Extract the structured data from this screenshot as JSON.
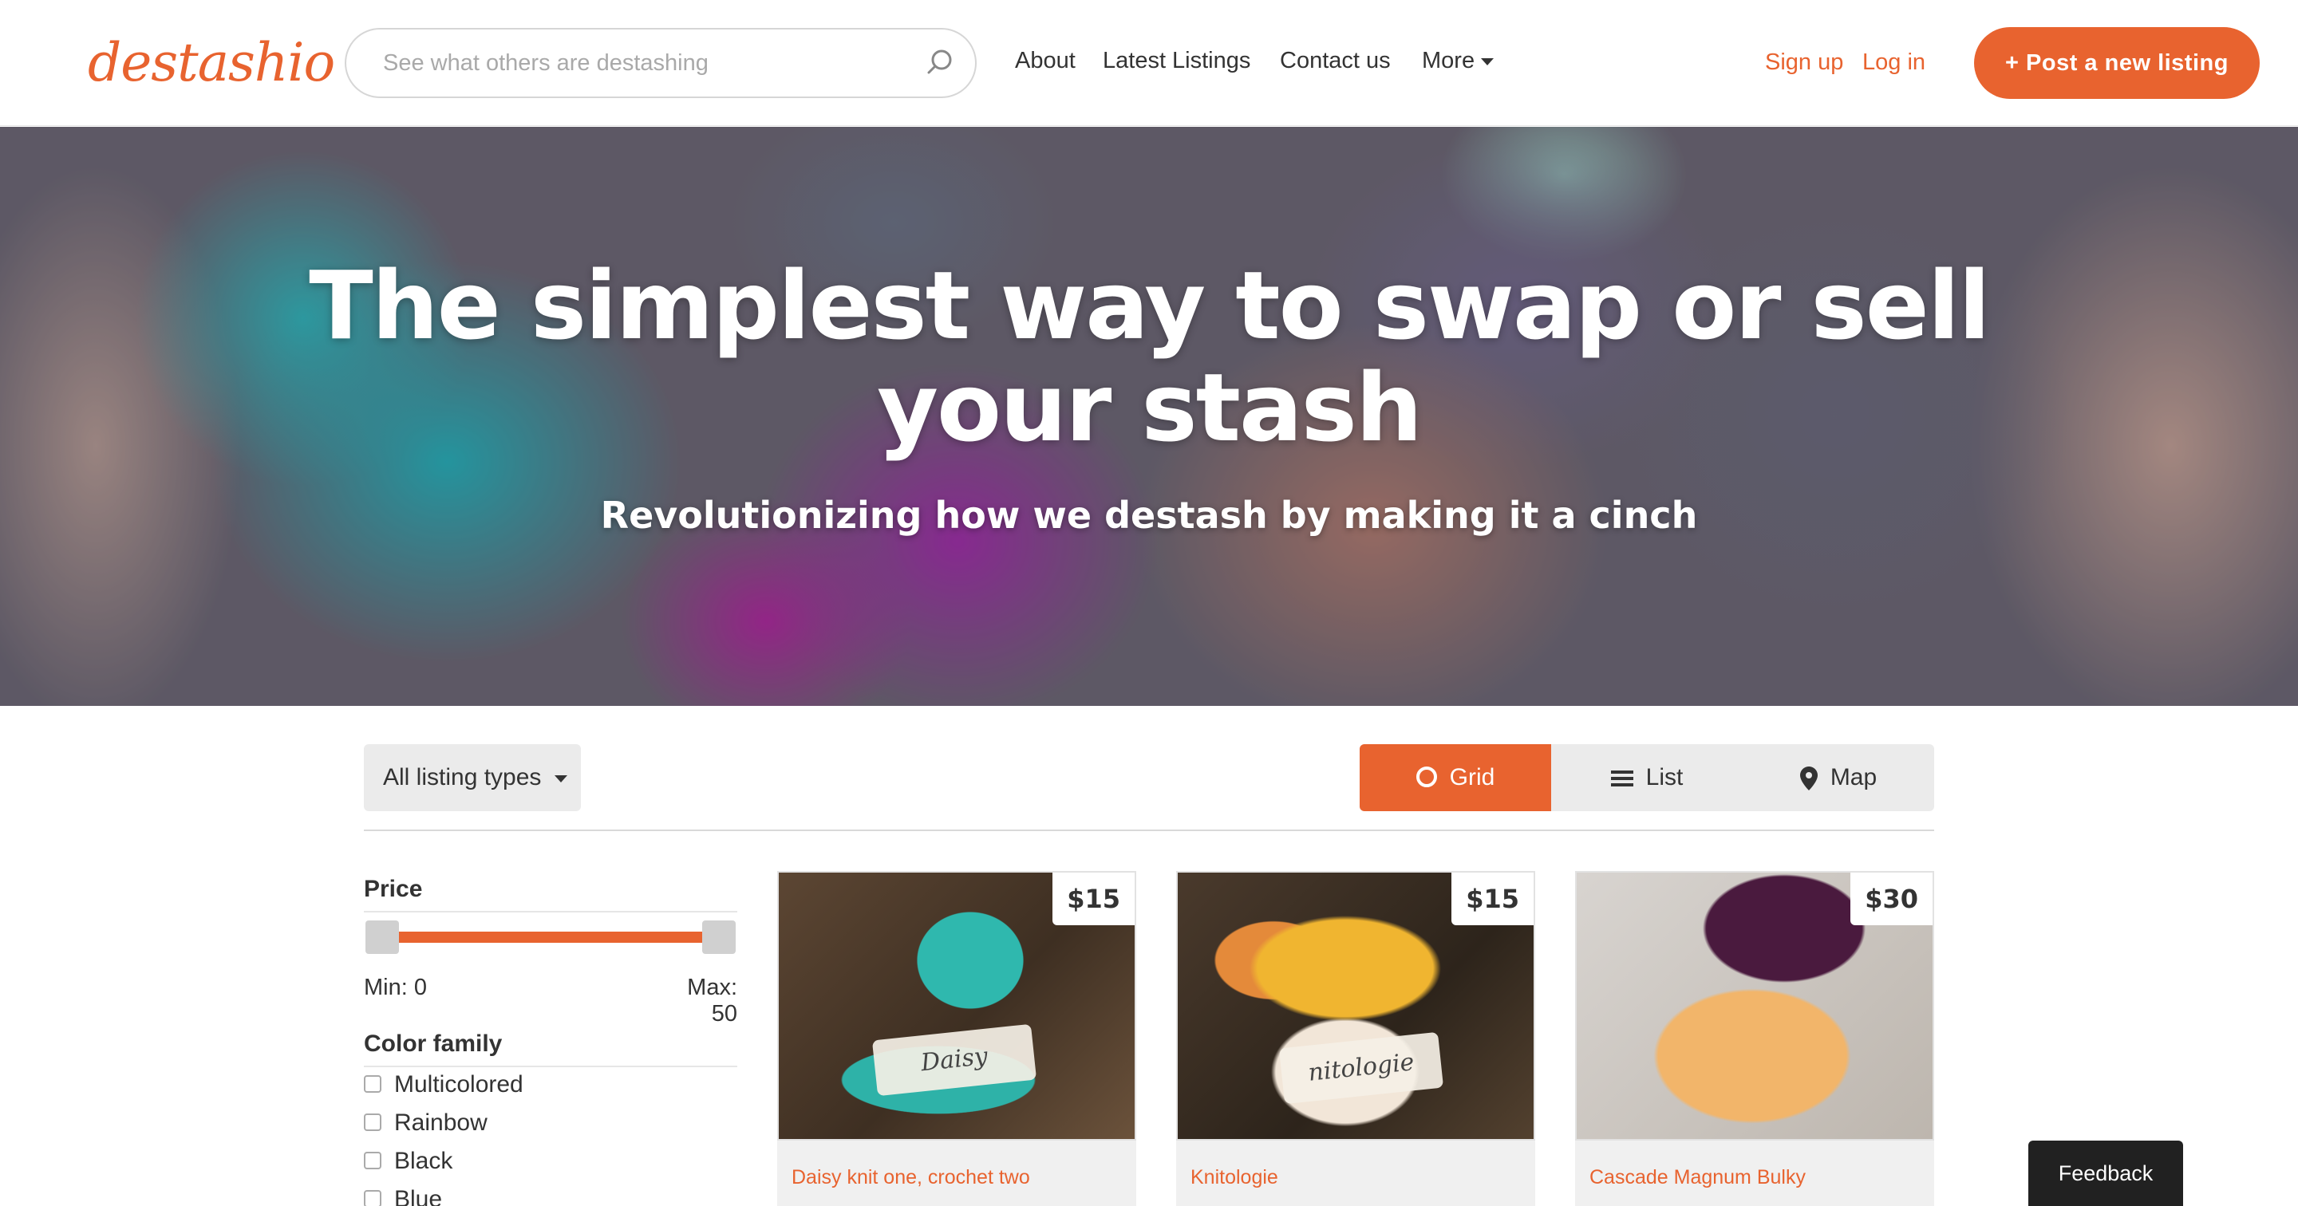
{
  "brand": {
    "logo_text": "destashio",
    "accent_color": "#e8632f"
  },
  "header": {
    "search_placeholder": "See what others are destashing",
    "nav": {
      "about": "About",
      "latest": "Latest Listings",
      "contact": "Contact us",
      "more": "More"
    },
    "signup": "Sign up",
    "login": "Log in",
    "post_button": "+ Post a new listing"
  },
  "hero": {
    "title": "The simplest way to swap or sell your stash",
    "subtitle": "Revolutionizing how we destash by making it a cinch"
  },
  "toolbar": {
    "listing_types": "All listing types",
    "views": {
      "grid": "Grid",
      "list": "List",
      "map": "Map",
      "active": "grid"
    }
  },
  "filters": {
    "price": {
      "heading": "Price",
      "min_label": "Min: 0",
      "max_label": "Max: 50",
      "min": 0,
      "max": 50
    },
    "color": {
      "heading": "Color family",
      "options": [
        "Multicolored",
        "Rainbow",
        "Black",
        "Blue"
      ]
    }
  },
  "listings": [
    {
      "title": "Daisy knit one, crochet two",
      "price": "$15",
      "label": "Daisy"
    },
    {
      "title": "Knitologie",
      "price": "$15",
      "label": "nitologie"
    },
    {
      "title": "Cascade Magnum Bulky",
      "price": "$30",
      "label": ""
    }
  ],
  "feedback": "Feedback"
}
